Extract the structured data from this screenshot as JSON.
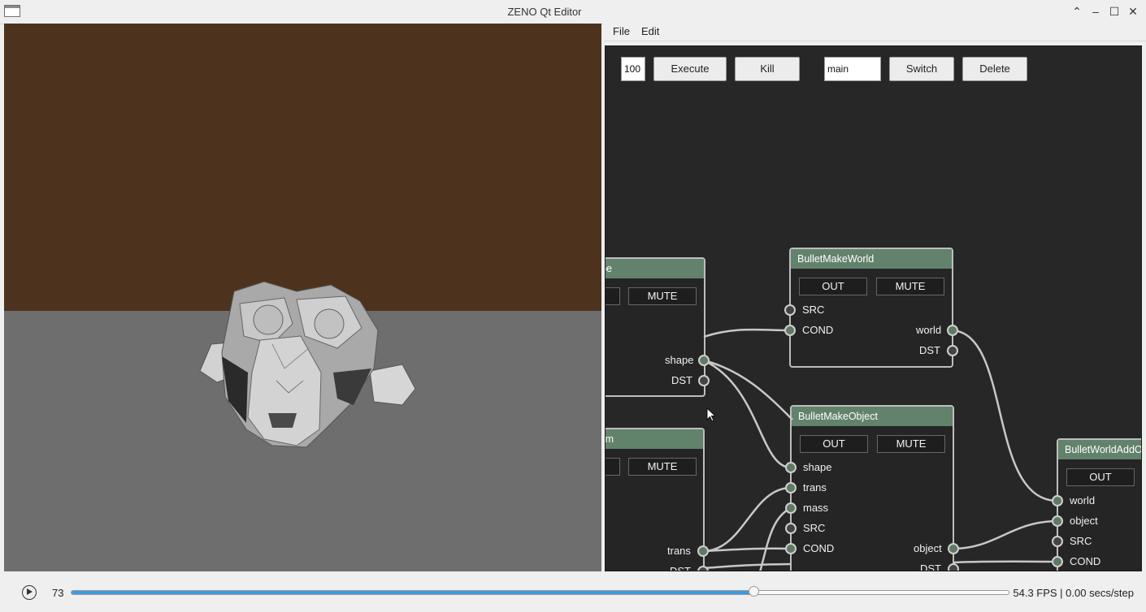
{
  "window": {
    "title": "ZENO Qt Editor",
    "controls": [
      "⌃",
      "–",
      "☐",
      "✕"
    ]
  },
  "menubar": {
    "file": "File",
    "edit": "Edit"
  },
  "toolbar": {
    "frames_value": "100",
    "execute": "Execute",
    "kill": "Kill",
    "graph_name": "main",
    "switch": "Switch",
    "delete": "Delete"
  },
  "nodes": {
    "box_shape": {
      "title": "BulletMakeBoxShape",
      "mute": "MUTE",
      "out_shape": "shape",
      "out_dst": "DST"
    },
    "make_world": {
      "title": "BulletMakeWorld",
      "out": "OUT",
      "mute": "MUTE",
      "in_src": "SRC",
      "in_cond": "COND",
      "out_world": "world",
      "out_dst": "DST"
    },
    "make_object": {
      "title": "BulletMakeObject",
      "out": "OUT",
      "mute": "MUTE",
      "in_shape": "shape",
      "in_trans": "trans",
      "in_mass": "mass",
      "in_src": "SRC",
      "in_cond": "COND",
      "out_object": "object",
      "out_dst": "DST"
    },
    "transform": {
      "title": "BulletMakeTransform",
      "mute": "MUTE",
      "out_trans": "trans",
      "out_dst": "DST"
    },
    "world_add": {
      "title": "BulletWorldAddObject",
      "out": "OUT",
      "in_world": "world",
      "in_object": "object",
      "in_src": "SRC",
      "in_cond": "COND"
    }
  },
  "timeline": {
    "frame": "73",
    "progress": 0.727,
    "fps": "54.3 FPS | 0.00 secs/step"
  },
  "colors": {
    "sky": "#4d331d",
    "ground": "#6e6e6e",
    "node_header": "#62826c",
    "editor_bg": "#272727",
    "slider_fill": "#3d9be0"
  }
}
